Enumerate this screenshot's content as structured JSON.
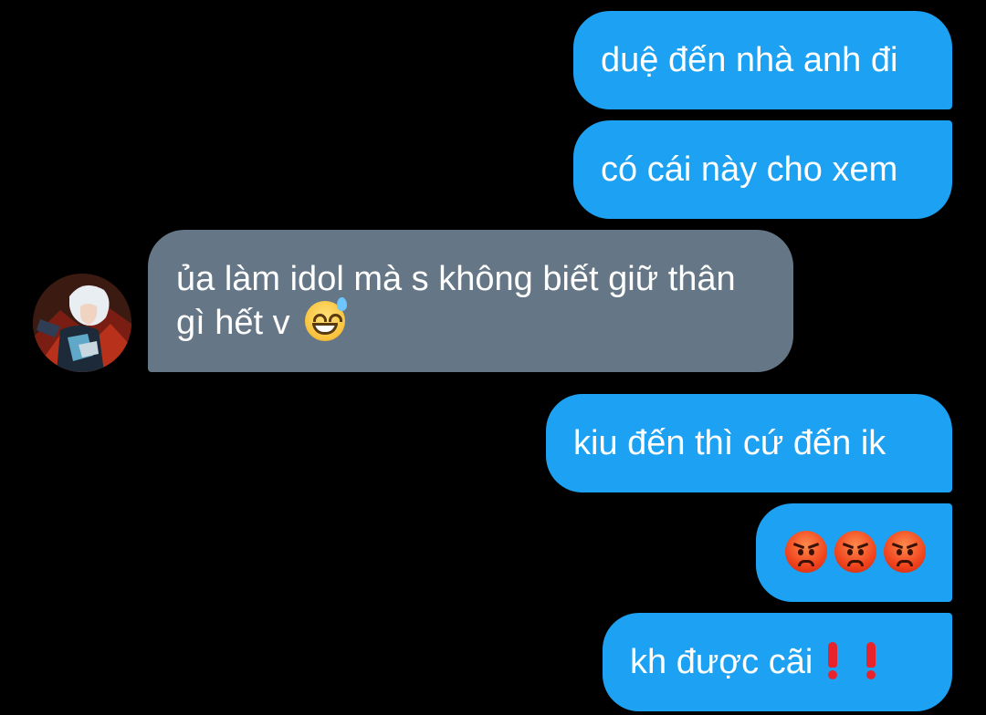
{
  "conversation": {
    "messages": [
      {
        "direction": "outgoing",
        "text": "duệ đến nhà anh đi"
      },
      {
        "direction": "outgoing",
        "text": "có cái này cho xem"
      },
      {
        "direction": "incoming",
        "text": "ủa làm idol mà s không biết giữ thân gì hết v",
        "trailing_emoji": "grinning-face-with-sweat"
      },
      {
        "direction": "outgoing",
        "text": "kiu đến thì cứ đến ik"
      },
      {
        "direction": "outgoing",
        "text": "",
        "emojis": [
          "pouting-face",
          "pouting-face",
          "pouting-face"
        ]
      },
      {
        "direction": "outgoing",
        "text": "kh được cãi",
        "trailing_emojis": [
          "exclamation-mark",
          "exclamation-mark"
        ]
      }
    ]
  },
  "colors": {
    "background": "#000000",
    "outgoing_bubble": "#1da1f2",
    "incoming_bubble": "#657786",
    "text": "#ffffff"
  }
}
